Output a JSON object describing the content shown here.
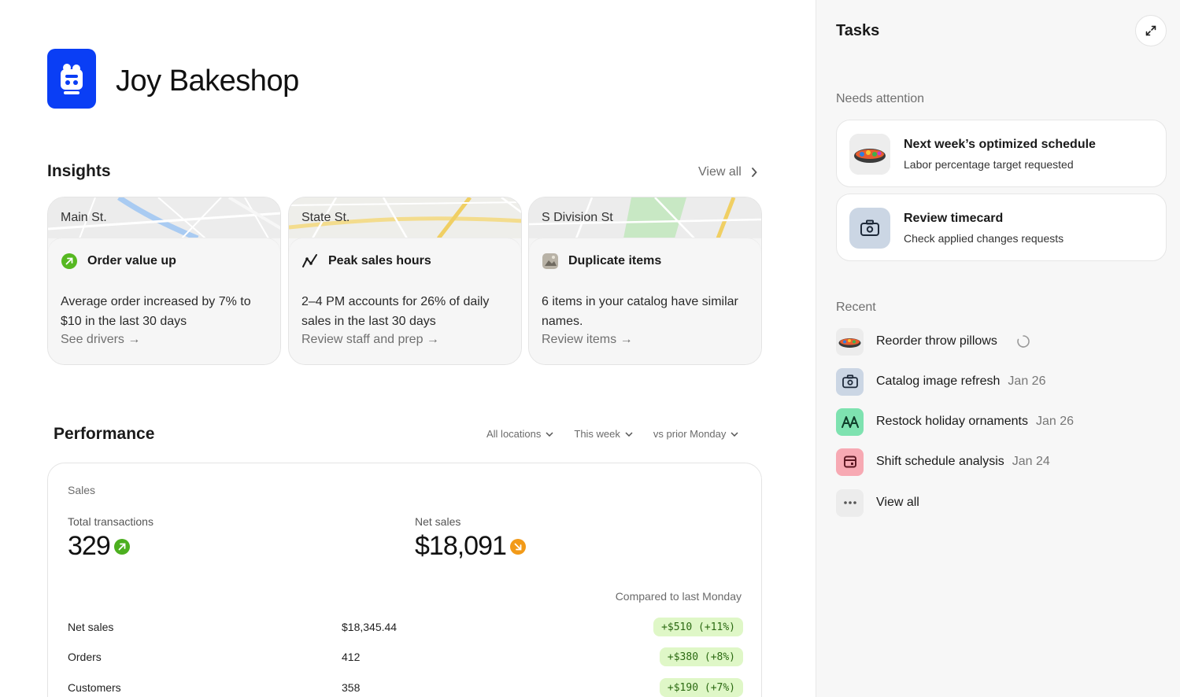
{
  "brand": {
    "name": "Joy Bakeshop",
    "logo_icon": "bakeshop-logo-icon",
    "logo_color": "#0a3ef5"
  },
  "insights": {
    "title": "Insights",
    "view_all": "View all",
    "cards": [
      {
        "location": "Main St.",
        "heading": "Order value up",
        "icon": "arrow-up-right-circle-icon",
        "text": "Average order increased by 7% to $10 in the last 30 days",
        "link": "See drivers →"
      },
      {
        "location": "State St.",
        "heading": "Peak sales hours",
        "icon": "trend-line-icon",
        "text": "2–4 PM accounts for 26% of daily sales in the last 30 days",
        "link": "Review staff and prep →"
      },
      {
        "location": "S Division St",
        "heading": "Duplicate items",
        "icon": "catalog-image-icon",
        "text": "6 items in your catalog have similar names.",
        "link": "Review items →"
      }
    ]
  },
  "performance": {
    "title": "Performance",
    "filters": [
      "All locations",
      "This week",
      "vs prior Monday"
    ],
    "sales_label": "Sales",
    "metrics": [
      {
        "label": "Total transactions",
        "value": "329",
        "trend_icon": "trend-up-icon",
        "trend_color": "#4caf1f"
      },
      {
        "label": "Net sales",
        "value": "$18,091",
        "trend_icon": "trend-down-icon",
        "trend_color": "#f29a18"
      }
    ],
    "compare_label": "Compared to last Monday",
    "rows": [
      {
        "name": "Net sales",
        "value": "$18,345.44",
        "delta": "+$510 (+11%)"
      },
      {
        "name": "Orders",
        "value": "412",
        "delta": "+$380 (+8%)"
      },
      {
        "name": "Customers",
        "value": "358",
        "delta": "+$190 (+7%)"
      }
    ]
  },
  "tasks": {
    "title": "Tasks",
    "needs_attention_label": "Needs attention",
    "attention": [
      {
        "title": "Next week’s optimized schedule",
        "subtitle": "Labor percentage target requested",
        "icon": "colorful-bowl-icon"
      },
      {
        "title": "Review timecard",
        "subtitle": "Check applied changes requests",
        "icon": "camera-icon"
      }
    ],
    "recent_label": "Recent",
    "recent": [
      {
        "label": "Reorder throw pillows",
        "date": "",
        "icon": "colorful-bowl-icon",
        "status": "loading-spinner-icon"
      },
      {
        "label": "Catalog image refresh",
        "date": "Jan 26",
        "icon": "camera-icon"
      },
      {
        "label": "Restock holiday ornaments",
        "date": "Jan 26",
        "icon": "ornament-icon"
      },
      {
        "label": "Shift schedule analysis",
        "date": "Jan 24",
        "icon": "calendar-icon"
      },
      {
        "label": "View all",
        "date": "",
        "icon": "more-dots-icon"
      }
    ]
  }
}
